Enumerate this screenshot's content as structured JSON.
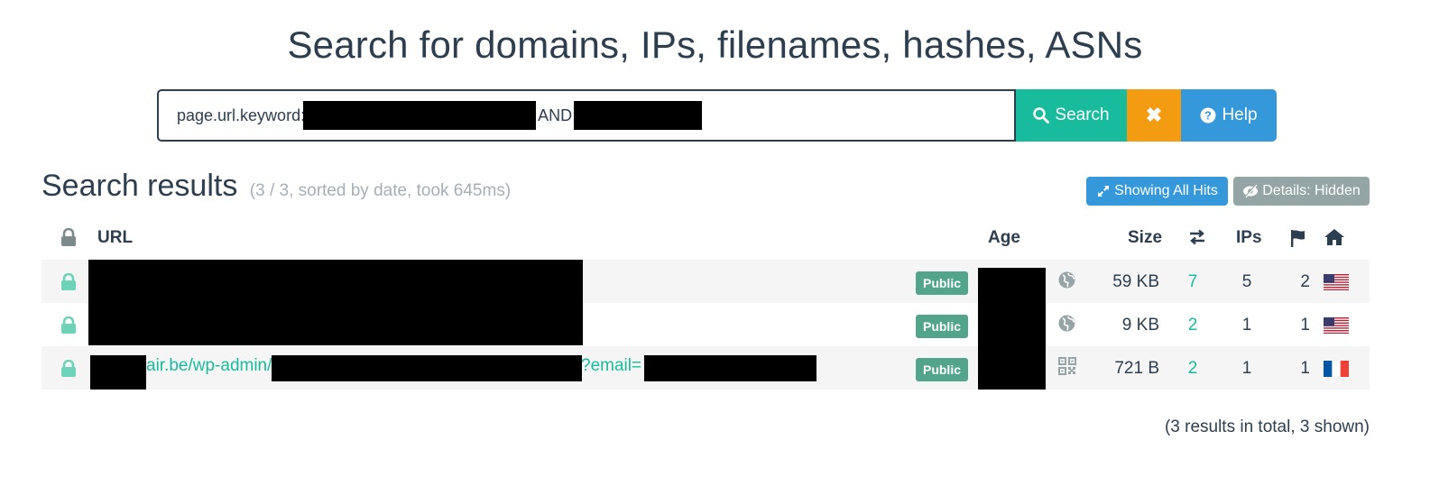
{
  "title": "Search for domains, IPs, filenames, hashes, ASNs",
  "search": {
    "query_prefix": "page.url.keyword:",
    "query_mid": "AND",
    "search_label": "Search",
    "clear_label": "✖",
    "help_label": "Help"
  },
  "results": {
    "heading": "Search results",
    "meta": "(3 / 3, sorted by date, took 645ms)",
    "showing_all_hits": "Showing All Hits",
    "details_hidden": "Details: Hidden"
  },
  "columns": {
    "url": "URL",
    "age": "Age",
    "size": "Size",
    "ips": "IPs"
  },
  "rows": [
    {
      "visibility": "Public",
      "size": "59 KB",
      "links": "7",
      "ips": "5",
      "countries": "2",
      "flag": "us",
      "page_icon": "globe-icon"
    },
    {
      "visibility": "Public",
      "size": "9 KB",
      "links": "2",
      "ips": "1",
      "countries": "1",
      "flag": "us",
      "page_icon": "globe-icon"
    },
    {
      "visibility": "Public",
      "size": "721 B",
      "links": "2",
      "ips": "1",
      "countries": "1",
      "flag": "fr",
      "page_icon": "qr-icon",
      "url_part1": "air.be/wp-admin/",
      "url_part2": "?email="
    }
  ],
  "footer": "(3 results in total, 3 shown)",
  "colors": {
    "accent_green": "#18bc9c",
    "primary_blue": "#3498db",
    "warning_orange": "#f39c12",
    "badge_green": "#52a58b",
    "text_dark": "#2c3e50",
    "muted_gray": "#95a5a6"
  }
}
